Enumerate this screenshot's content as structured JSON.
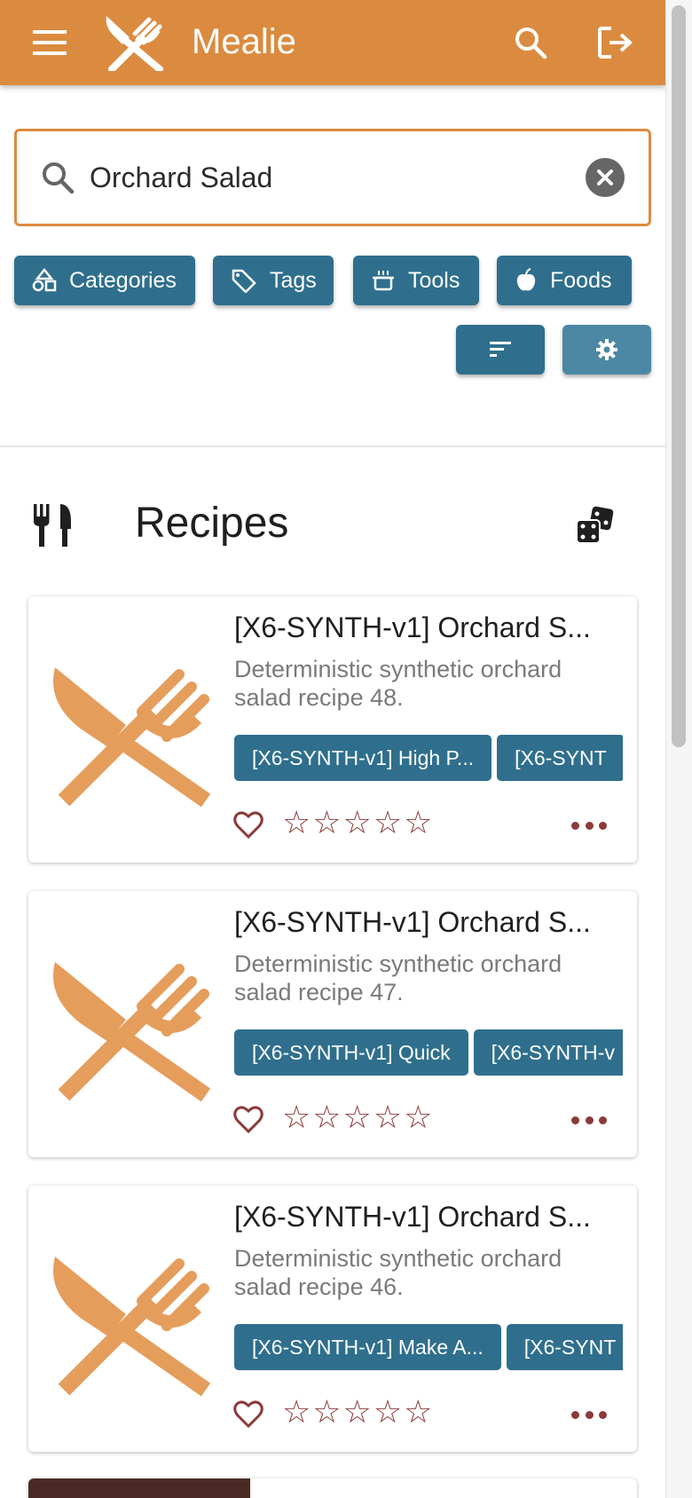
{
  "appbar": {
    "title": "Mealie",
    "color": "#db8b3f"
  },
  "search": {
    "value": "Orchard Salad",
    "placeholder": "Search"
  },
  "filters": [
    {
      "label": "Categories",
      "icon": "shapes-icon"
    },
    {
      "label": "Tags",
      "icon": "tag-multiple-icon"
    },
    {
      "label": "Tools",
      "icon": "pot-icon"
    },
    {
      "label": "Foods",
      "icon": "apple-icon"
    }
  ],
  "toolbar": {
    "sort_icon": "sort-icon",
    "settings_icon": "gear-icon"
  },
  "recipes_section": {
    "title": "Recipes"
  },
  "recipes": [
    {
      "title": "[X6-SYNTH-v1] Orchard S...",
      "description": "Deterministic synthetic orchard salad recipe 48.",
      "tags": [
        "[X6-SYNTH-v1] High P...",
        "[X6-SYNT"
      ],
      "rating": 0
    },
    {
      "title": "[X6-SYNTH-v1] Orchard S...",
      "description": "Deterministic synthetic orchard salad recipe 47.",
      "tags": [
        "[X6-SYNTH-v1] Quick",
        "[X6-SYNTH-v"
      ],
      "rating": 0
    },
    {
      "title": "[X6-SYNTH-v1] Orchard S...",
      "description": "Deterministic synthetic orchard salad recipe 46.",
      "tags": [
        "[X6-SYNTH-v1] Make A...",
        "[X6-SYNT"
      ],
      "rating": 0
    }
  ],
  "colors": {
    "primary": "#db8b3f",
    "accent": "#2f6f8d",
    "rating": "#8b3a3a"
  }
}
